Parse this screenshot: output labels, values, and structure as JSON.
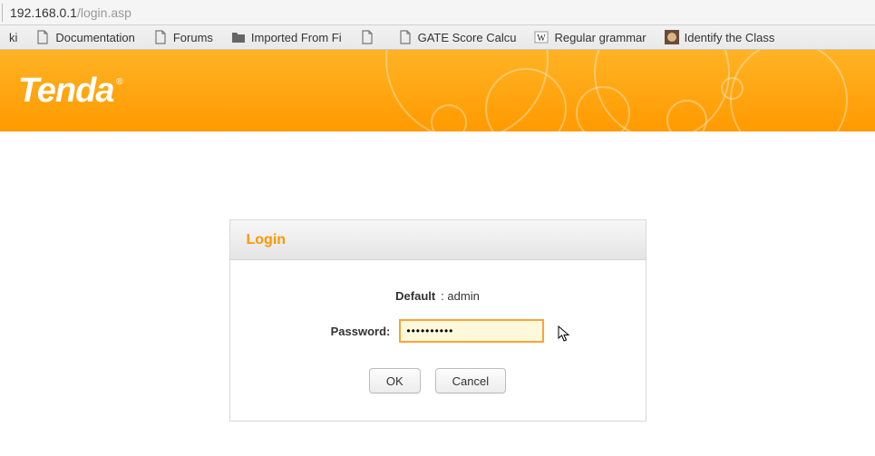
{
  "address": {
    "host": "192.168.0.1",
    "path": "/login.asp"
  },
  "bookmarks": {
    "items": [
      {
        "label": "ki"
      },
      {
        "label": "Documentation"
      },
      {
        "label": "Forums"
      },
      {
        "label": "Imported From Fi"
      },
      {
        "label": ""
      },
      {
        "label": "GATE Score Calcu"
      },
      {
        "label": "Regular grammar"
      },
      {
        "label": "Identify the Class"
      }
    ]
  },
  "brand": {
    "name": "Tenda"
  },
  "login": {
    "title": "Login",
    "default_label": "Default",
    "default_value": ": admin",
    "password_label": "Password:",
    "password_masked": "••••••••••",
    "ok_label": "OK",
    "cancel_label": "Cancel"
  }
}
